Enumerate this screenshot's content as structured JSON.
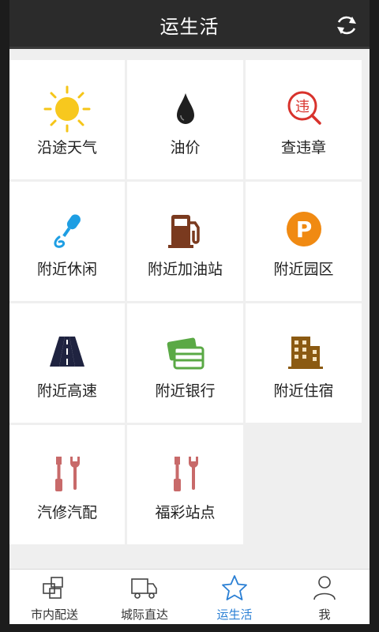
{
  "header": {
    "title": "运生活"
  },
  "grid": {
    "items": [
      {
        "label": "沿途天气"
      },
      {
        "label": "油价"
      },
      {
        "label": "查违章",
        "badge": "违"
      },
      {
        "label": "附近休闲"
      },
      {
        "label": "附近加油站"
      },
      {
        "label": "附近园区",
        "badge": "P"
      },
      {
        "label": "附近高速"
      },
      {
        "label": "附近银行"
      },
      {
        "label": "附近住宿"
      },
      {
        "label": "汽修汽配"
      },
      {
        "label": "福彩站点"
      }
    ]
  },
  "tabbar": {
    "tabs": [
      {
        "label": "市内配送"
      },
      {
        "label": "城际直达"
      },
      {
        "label": "运生活",
        "active": true
      },
      {
        "label": "我"
      }
    ]
  },
  "colors": {
    "accent": "#2a7fd4",
    "header_bg": "#2b2b2b"
  }
}
